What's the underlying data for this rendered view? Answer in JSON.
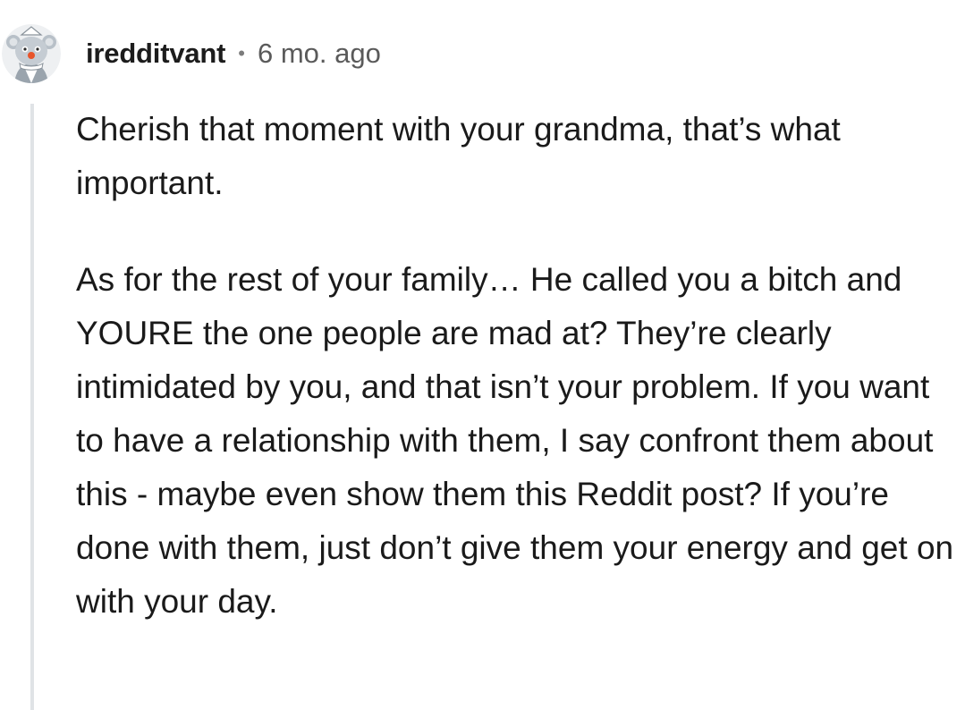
{
  "comment": {
    "author": {
      "username": "iredditvant",
      "avatar_icon": "snoo-avatar-icon"
    },
    "separator": "•",
    "timestamp": "6 mo. ago",
    "paragraphs": [
      "Cherish that moment with your grandma, that’s what important.",
      "As for the rest of your family… He called you a bitch and YOURE the one people are mad at? They’re clearly intimidated by you, and that isn’t your problem. If you want to have a relationship with them, I say confront them about this - maybe even show them this Reddit post? If you’re done with them, just don’t give them your energy and get on with your day."
    ]
  },
  "colors": {
    "background": "#ffffff",
    "text": "#1a1a1a",
    "muted": "#5a5a5a",
    "thread_line": "#e0e3e6"
  }
}
